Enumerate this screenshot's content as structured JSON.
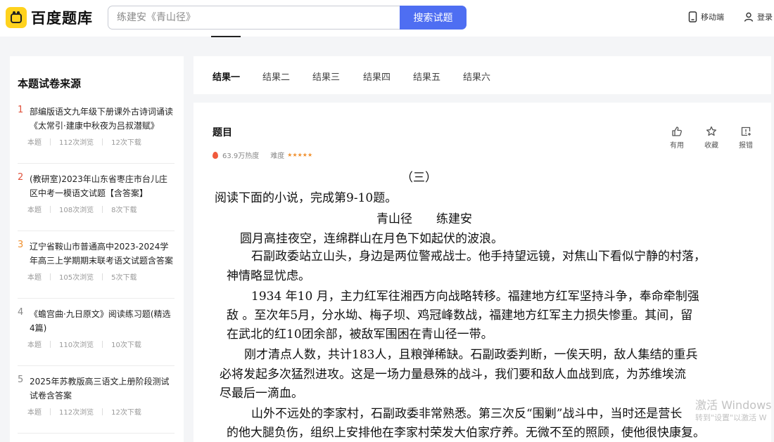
{
  "header": {
    "logo_text": "百度题库",
    "search_placeholder": "练建安《青山径》",
    "search_button": "搜索试题",
    "mobile_label": "移动端",
    "login_label": "登录"
  },
  "sidebar": {
    "heading": "本题试卷来源",
    "items": [
      {
        "num": "1",
        "title": "部编版语文九年级下册课外古诗词诵读《太常引·建康中秋夜为吕叔潜赋》阅...",
        "tag": "本题",
        "views": "112次浏览",
        "downloads": "12次下载"
      },
      {
        "num": "2",
        "title": "(教研室)2023年山东省枣庄市台儿庄区中考一模语文试题【含答案】",
        "tag": "本题",
        "views": "108次浏览",
        "downloads": "8次下载"
      },
      {
        "num": "3",
        "title": "辽宁省鞍山市普通高中2023-2024学年高三上学期期末联考语文试题含答案",
        "tag": "本题",
        "views": "105次浏览",
        "downloads": "5次下载"
      },
      {
        "num": "4",
        "title": "《蟾宫曲·九日原文》阅读练习题(精选4篇)",
        "tag": "本题",
        "views": "110次浏览",
        "downloads": "10次下载"
      },
      {
        "num": "5",
        "title": "2025年苏教版高三语文上册阶段测试试卷含答案",
        "tag": "本题",
        "views": "112次浏览",
        "downloads": "12次下载"
      }
    ]
  },
  "tabs": [
    "结果一",
    "结果二",
    "结果三",
    "结果四",
    "结果五",
    "结果六"
  ],
  "question": {
    "title": "题目",
    "heat": "63.9万热度",
    "difficulty_label": "难度",
    "difficulty_stars": 5,
    "actions": {
      "useful": "有用",
      "collect": "收藏",
      "report": "报错"
    },
    "lines": [
      "（三）",
      "阅读下面的小说，完成第9-10题。",
      "青山径　　练建安",
      "圆月高挂夜空，连绵群山在月色下如起伏的波浪。",
      "石副政委站立山头，身边是两位警戒战士。他手持望远镜，对焦山下看似宁静的村落，",
      "神情略显忧虑。",
      "1934 年10 月，主力红军往湘西方向战略转移。福建地方红军坚持斗争，奉命牵制强",
      "敌 。至次年5月，分水坳、梅子坝、鸡冠峰数战，福建地方红军主力损失惨重。其间，留",
      "在武北的红10团余部，被敌军围困在青山径一带。",
      "刚才清点人数，共计183人，且粮弹稀缺。石副政委判断，一俟天明，敌人集结的重兵",
      "必将发起多次猛烈进攻。这是一场力量悬殊的战斗，我们要和敌人血战到底，为苏维埃流",
      "尽最后一滴血。",
      "山外不远处的李家村，石副政委非常熟悉。第三次反“围剿”战斗中，当时还是营长",
      "的他大腿负伤，组织上安排他在李家村荣发大伯家疗养。无微不至的照顾，使他很快康复。"
    ]
  },
  "watermark": {
    "line1": "激活 Windows",
    "line2": "转到\"设置\"以激活 W"
  }
}
